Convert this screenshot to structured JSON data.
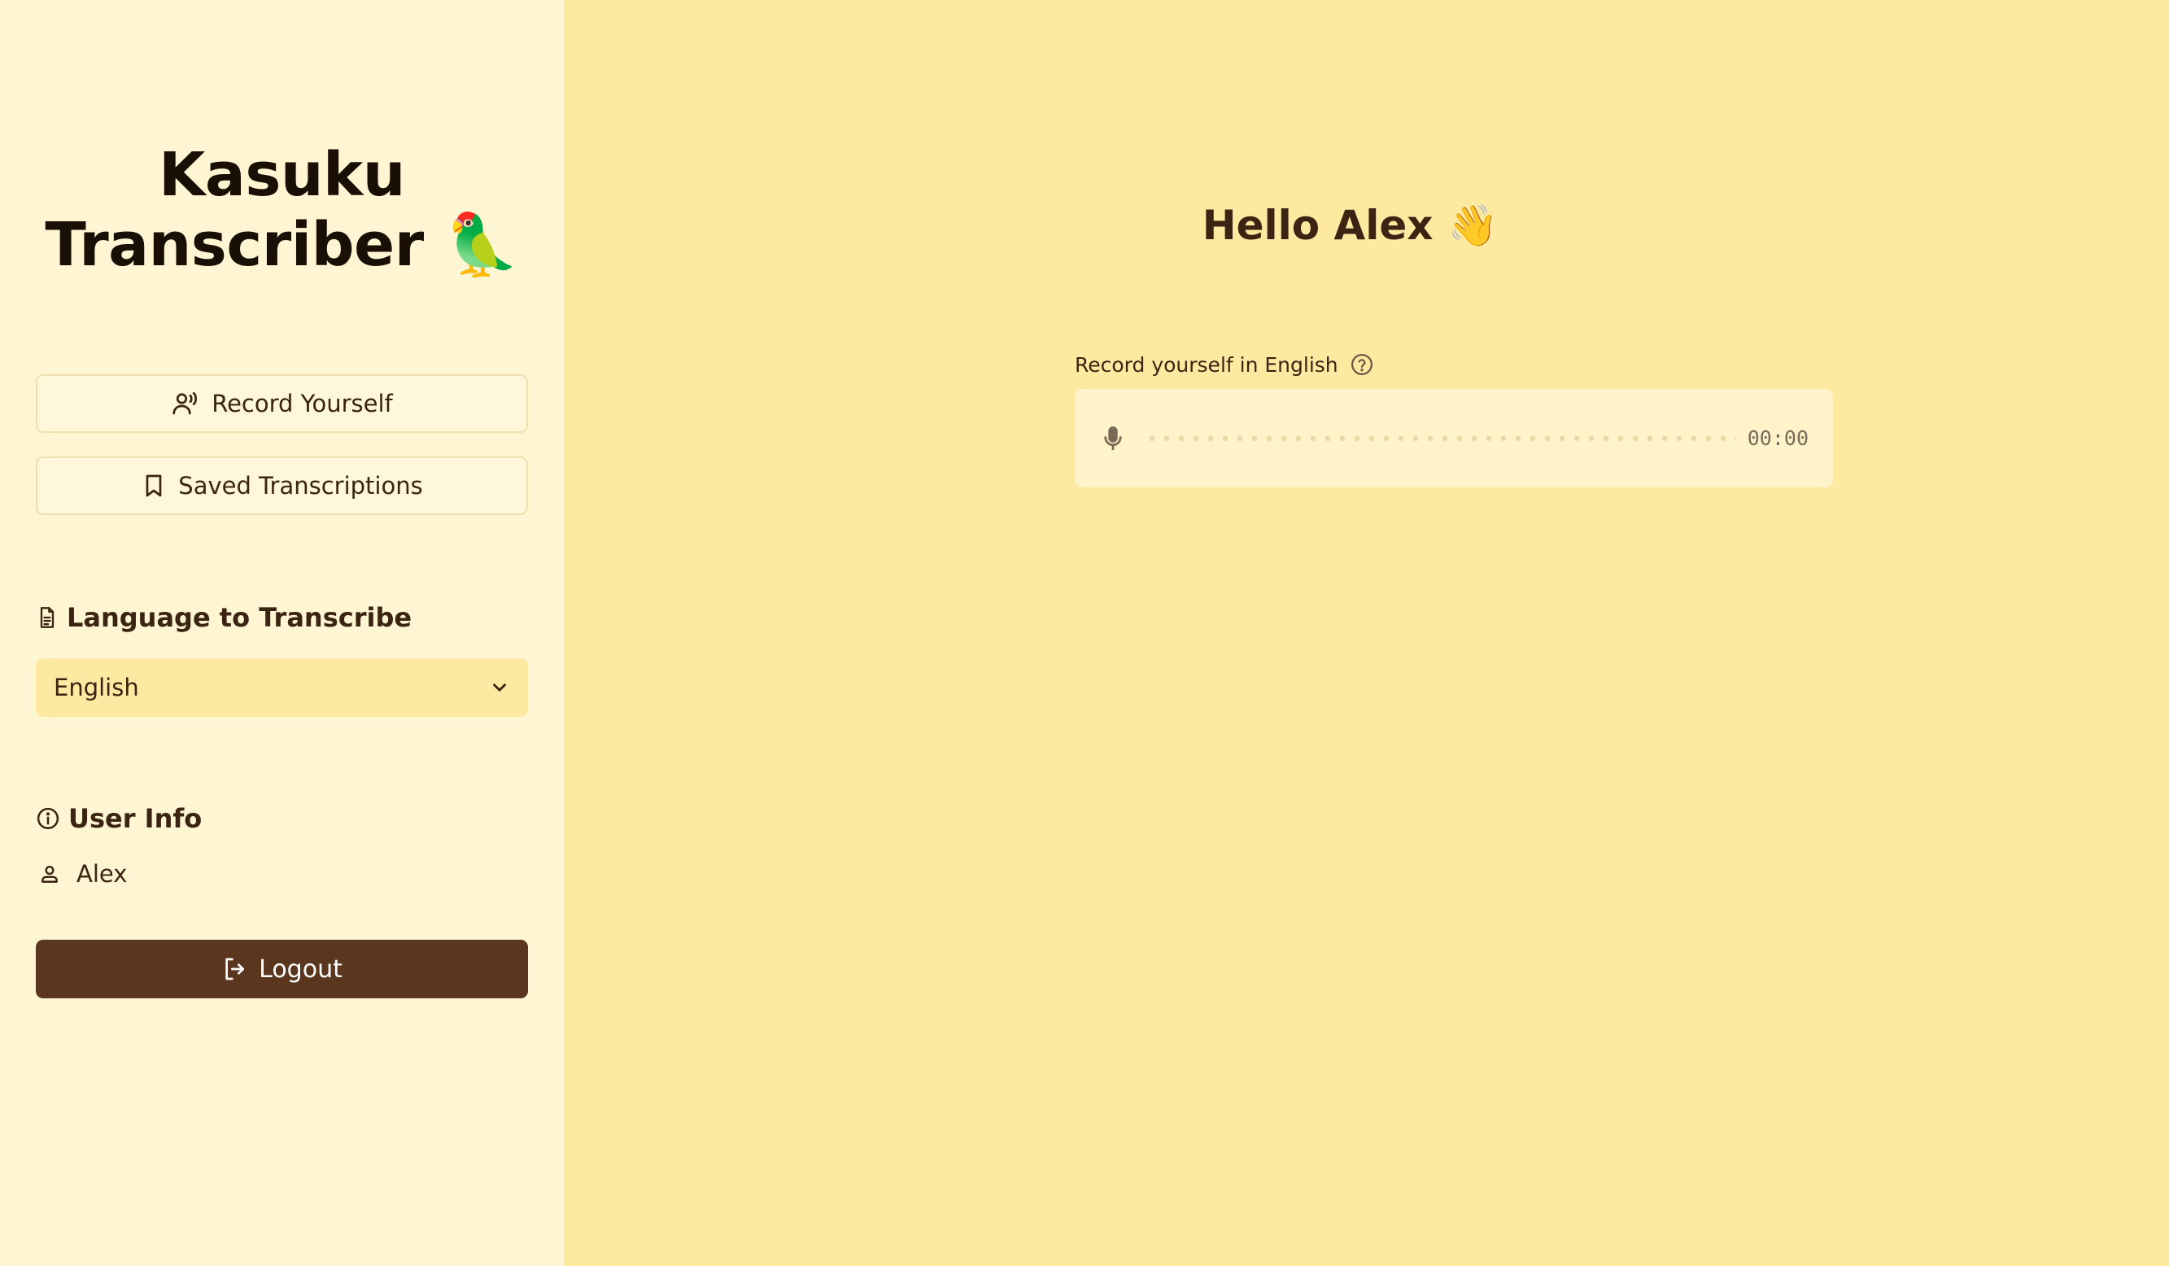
{
  "sidebar": {
    "title_line1": "Kasuku",
    "title_line2": "Transcriber 🦜",
    "record_label": "Record Yourself",
    "saved_label": "Saved Transcriptions",
    "language_heading": "Language to Transcribe",
    "language_selected": "English",
    "user_info_heading": "User Info",
    "user_name": "Alex",
    "logout_label": "Logout"
  },
  "main": {
    "greeting": "Hello Alex 👋",
    "record_prompt": "Record yourself in English",
    "timer": "00:00"
  },
  "icons": {
    "record": "voice-user-icon",
    "saved": "bookmark-icon",
    "language": "document-icon",
    "select": "chevron-down-icon",
    "user_info": "info-icon",
    "user": "user-icon",
    "logout": "logout-icon",
    "help": "help-circle-icon",
    "mic": "microphone-icon"
  },
  "colors": {
    "sidebar_bg": "#fef5d2",
    "main_bg": "#fee9a1",
    "accent": "#5a361e",
    "text": "#3b2412"
  }
}
